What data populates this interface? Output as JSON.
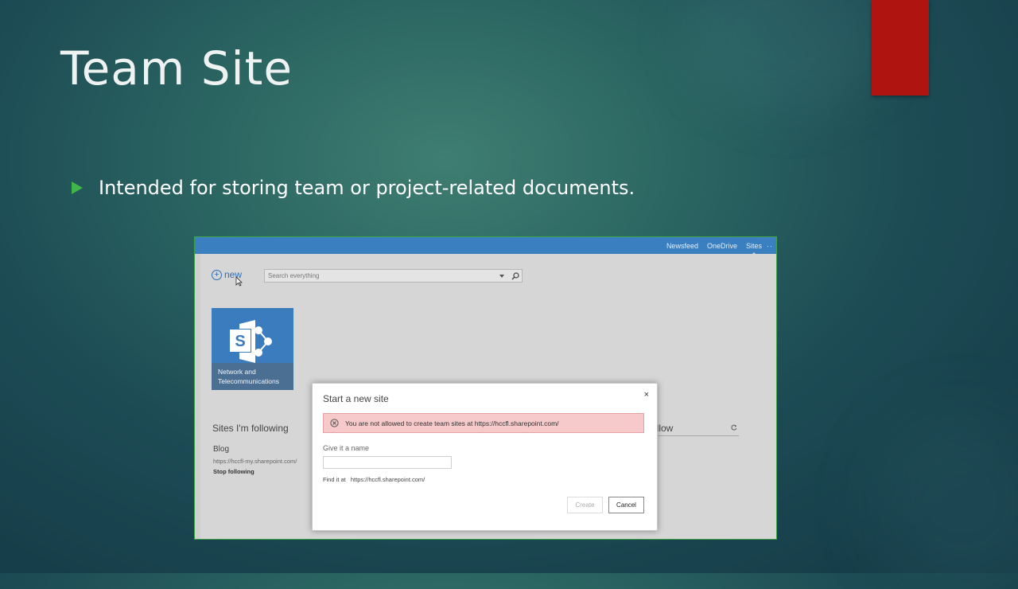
{
  "slide": {
    "title": "Team Site",
    "bullet": "Intended for storing team or project-related documents."
  },
  "sharepoint": {
    "top_nav": [
      "Newsfeed",
      "OneDrive",
      "Sites"
    ],
    "top_nav_active": "Sites",
    "top_nav_more": "··",
    "new_label": "new",
    "search_placeholder": "Search everything",
    "tile": {
      "icon": "sharepoint-logo-icon",
      "letter": "S",
      "caption_line1": "Network and",
      "caption_line2": "Telecommunications"
    },
    "sites_following_heading": "Sites I'm following",
    "suggested_heading_fragment": "ollow",
    "blog": {
      "name": "Blog",
      "url": "https://hccfl-my.sharepoint.com/",
      "stop_label": "Stop following"
    }
  },
  "dialog": {
    "title": "Start a new site",
    "close": "×",
    "error": "You are not allowed to create team sites at https://hccfl.sharepoint.com/",
    "name_label": "Give it a name",
    "name_value": "",
    "find_label": "Find it at",
    "find_url": "https://hccfl.sharepoint.com/",
    "create_label": "Create",
    "cancel_label": "Cancel"
  },
  "colors": {
    "accent_bar": "#b01410",
    "bullet_arrow": "#3fb64a",
    "suite_bar": "#3a7fc0",
    "error_bg": "#f6c9ca"
  }
}
